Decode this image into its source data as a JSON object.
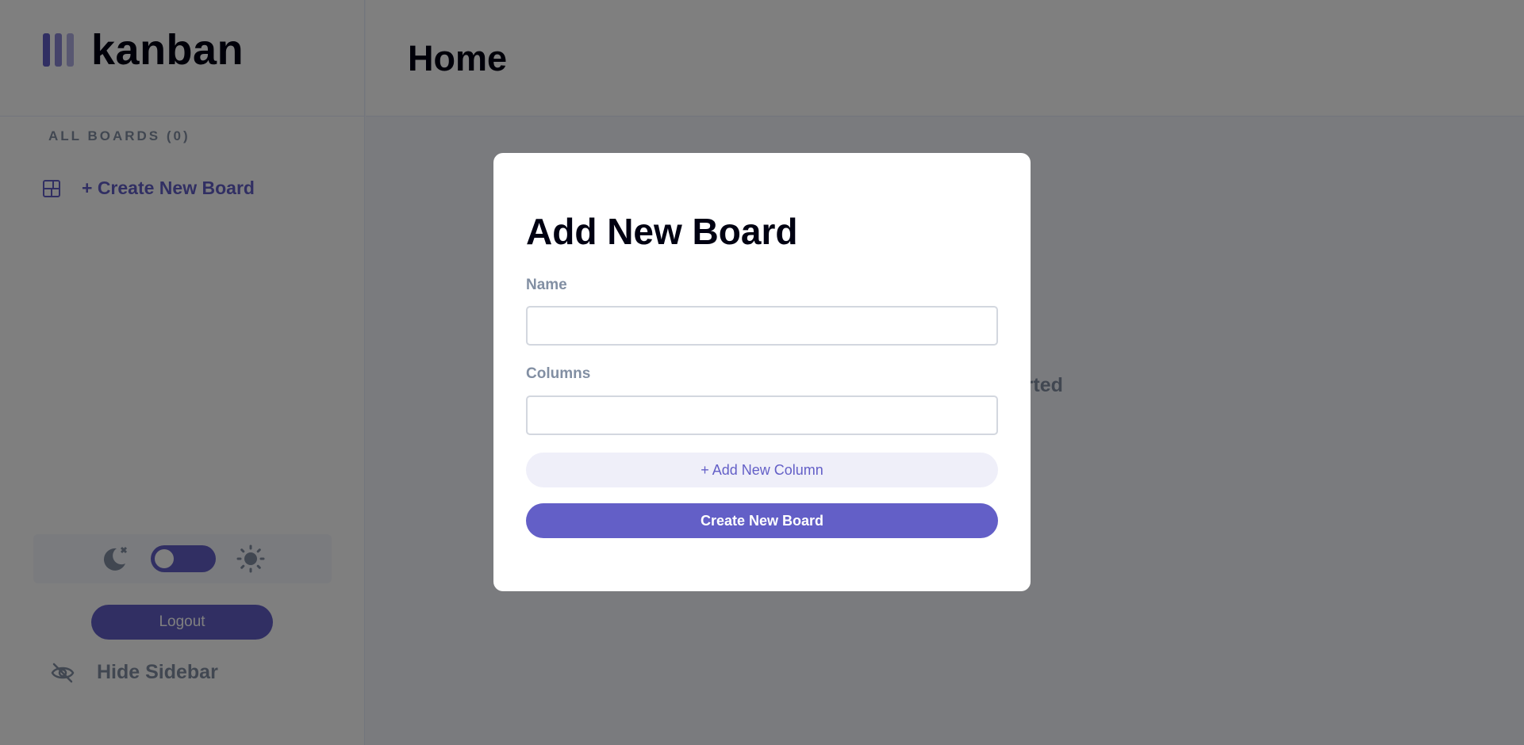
{
  "app": {
    "logo_text": "kanban"
  },
  "sidebar": {
    "boards_heading": "ALL BOARDS (0)",
    "create_board_label": "+ Create New Board",
    "logout_label": "Logout",
    "hide_sidebar_label": "Hide Sidebar"
  },
  "header": {
    "title": "Home"
  },
  "main": {
    "empty_message": "get started"
  },
  "modal": {
    "title": "Add New Board",
    "name_label": "Name",
    "name_value": "",
    "columns_label": "Columns",
    "column_value": "",
    "add_column_label": "+ Add New Column",
    "submit_label": "Create New Board"
  },
  "colors": {
    "accent": "#635fc7",
    "accent_light": "#efeff9",
    "muted_text": "#828fa3",
    "dark_text": "#000112",
    "overlay": "rgba(0,0,0,0.5)"
  },
  "icons": {
    "logo": "kanban-logo-icon",
    "board": "board-icon",
    "moon": "moon-icon",
    "sun": "sun-icon",
    "hide": "eye-slash-icon"
  },
  "theme_toggle": {
    "mode": "dark"
  }
}
